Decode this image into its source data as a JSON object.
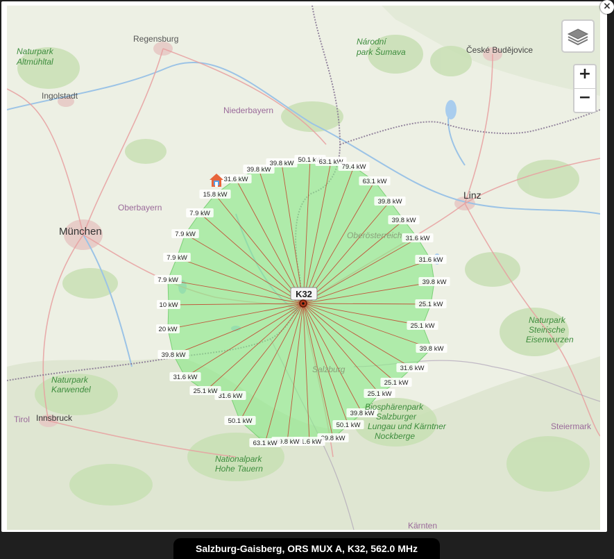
{
  "map": {
    "places": [
      {
        "name": "Regensburg"
      },
      {
        "name": "Naturpark Altmühltal"
      },
      {
        "name": "Ingolstadt"
      },
      {
        "name": "Niederbayern"
      },
      {
        "name": "Národní park Šumava"
      },
      {
        "name": "České Budějovice"
      },
      {
        "name": "Oberbayern"
      },
      {
        "name": "München"
      },
      {
        "name": "Linz"
      },
      {
        "name": "Oberösterreich"
      },
      {
        "name": "Salzburg"
      },
      {
        "name": "Naturpark Karwendel"
      },
      {
        "name": "Tirol"
      },
      {
        "name": "Innsbruck"
      },
      {
        "name": "Nationalpark Hohe Tauern"
      },
      {
        "name": "Biosphärenpark Salzburger Lungau und Kärntner Nockberge"
      },
      {
        "name": "Naturpark Steirische Eisenwurzen"
      },
      {
        "name": "Steiermark"
      },
      {
        "name": "Kärnten"
      }
    ],
    "transmitter_label": "K32",
    "power_labels": [
      "50.1 kW",
      "63.1 kW",
      "79.4 kW",
      "63.1 kW",
      "39.8 kW",
      "39.8 kW",
      "31.6 kW",
      "31.6 kW",
      "39.8 kW",
      "25.1 kW",
      "25.1 kW",
      "39.8 kW",
      "31.6 kW",
      "25.1 kW",
      "25.1 kW",
      "39.8 kW",
      "50.1 kW",
      "39.8 kW",
      "31.6 kW",
      "39.8 kW",
      "63.1 kW",
      "50.1 kW",
      "31.6 kW",
      "25.1 kW",
      "31.6 kW",
      "39.8 kW",
      "20 kW",
      "10 kW",
      "7.9 kW",
      "7.9 kW",
      "7.9 kW",
      "7.9 kW",
      "15.8 kW",
      "31.6 kW",
      "39.8 kW",
      "39.8 kW"
    ],
    "coverage_color": "#8ee88a",
    "ray_color": "#c0563a"
  },
  "controls": {
    "zoom_in": "+",
    "zoom_out": "−",
    "close": "×",
    "layers_icon": "layers-icon"
  },
  "caption": "Salzburg-Gaisberg, ORS MUX A, K32, 562.0 MHz"
}
